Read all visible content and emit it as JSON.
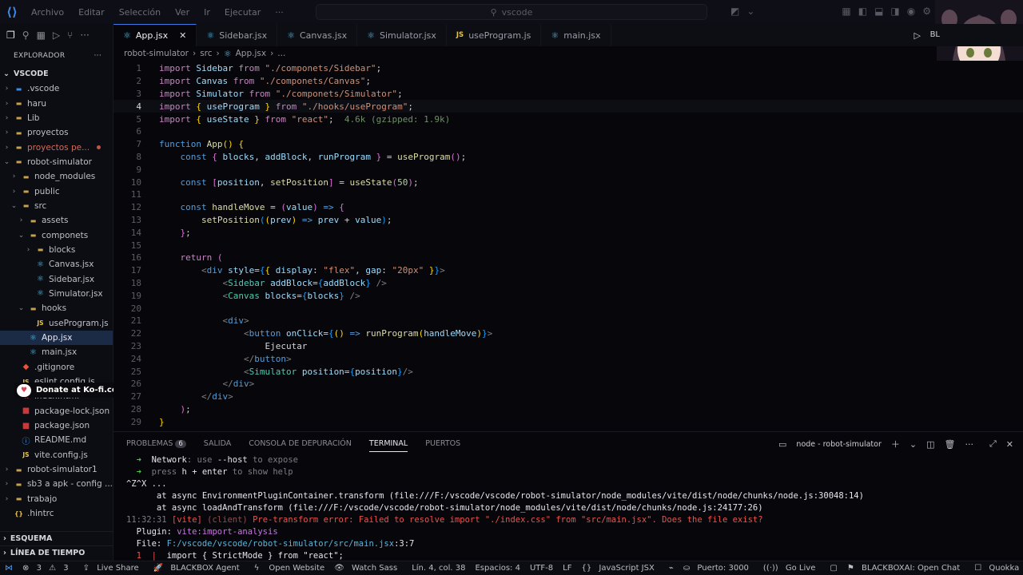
{
  "titlebar": {
    "menu": [
      "Archivo",
      "Editar",
      "Selección",
      "Ver",
      "Ir",
      "Ejecutar",
      "···"
    ],
    "search": "vscode"
  },
  "sidebar": {
    "title": "EXPLORADOR",
    "more": "···",
    "root": "VSCODE",
    "items": [
      {
        "label": ".vscode",
        "depth": 1,
        "type": "folder",
        "open": false,
        "icon": "vscode-folder-icon"
      },
      {
        "label": "haru",
        "depth": 1,
        "type": "folder",
        "open": false
      },
      {
        "label": "Lib",
        "depth": 1,
        "type": "folder",
        "open": false
      },
      {
        "label": "proyectos",
        "depth": 1,
        "type": "folder",
        "open": false
      },
      {
        "label": "proyectos pe...",
        "depth": 1,
        "type": "folder",
        "open": false,
        "modified": true
      },
      {
        "label": "robot-simulator",
        "depth": 1,
        "type": "folder",
        "open": true
      },
      {
        "label": "node_modules",
        "depth": 2,
        "type": "folder",
        "open": false
      },
      {
        "label": "public",
        "depth": 2,
        "type": "folder",
        "open": false
      },
      {
        "label": "src",
        "depth": 2,
        "type": "folder",
        "open": true
      },
      {
        "label": "assets",
        "depth": 3,
        "type": "folder",
        "open": false
      },
      {
        "label": "componets",
        "depth": 3,
        "type": "folder",
        "open": true
      },
      {
        "label": "blocks",
        "depth": 4,
        "type": "folder",
        "open": false
      },
      {
        "label": "Canvas.jsx",
        "depth": 4,
        "type": "react"
      },
      {
        "label": "Sidebar.jsx",
        "depth": 4,
        "type": "react"
      },
      {
        "label": "Simulator.jsx",
        "depth": 4,
        "type": "react"
      },
      {
        "label": "hooks",
        "depth": 3,
        "type": "folder",
        "open": true
      },
      {
        "label": "useProgram.js",
        "depth": 4,
        "type": "js"
      },
      {
        "label": "App.jsx",
        "depth": 3,
        "type": "react",
        "selected": true
      },
      {
        "label": "main.jsx",
        "depth": 3,
        "type": "react"
      },
      {
        "label": ".gitignore",
        "depth": 2,
        "type": "git"
      },
      {
        "label": "eslint.config.js",
        "depth": 2,
        "type": "js"
      },
      {
        "label": "index.html",
        "depth": 2,
        "type": "html"
      },
      {
        "label": "package-lock.json",
        "depth": 2,
        "type": "npm"
      },
      {
        "label": "package.json",
        "depth": 2,
        "type": "npm"
      },
      {
        "label": "README.md",
        "depth": 2,
        "type": "md"
      },
      {
        "label": "vite.config.js",
        "depth": 2,
        "type": "js"
      },
      {
        "label": "robot-simulator1",
        "depth": 1,
        "type": "folder",
        "open": false
      },
      {
        "label": "sb3 a apk - config ...",
        "depth": 1,
        "type": "folder",
        "open": false
      },
      {
        "label": "trabajo",
        "depth": 1,
        "type": "folder",
        "open": false
      },
      {
        "label": ".hintrc",
        "depth": 1,
        "type": "json"
      }
    ],
    "outline": "ESQUEMA",
    "timeline": "LÍNEA DE TIEMPO"
  },
  "donate": "Donate at Ko-fi.com/tiagovelko",
  "tabs": [
    {
      "label": "App.jsx",
      "type": "react",
      "active": true
    },
    {
      "label": "Sidebar.jsx",
      "type": "react"
    },
    {
      "label": "Canvas.jsx",
      "type": "react"
    },
    {
      "label": "Simulator.jsx",
      "type": "react"
    },
    {
      "label": "useProgram.js",
      "type": "js"
    },
    {
      "label": "main.jsx",
      "type": "react"
    }
  ],
  "tab_run_label": "BL",
  "breadcrumb": [
    "robot-simulator",
    "src",
    "App.jsx",
    "..."
  ],
  "editor": {
    "current_line": 4,
    "hint_line5": "4.6k (gzipped: 1.9k)"
  },
  "panel": {
    "tabs": [
      "PROBLEMAS",
      "SALIDA",
      "CONSOLA DE DEPURACIÓN",
      "TERMINAL",
      "PUERTOS"
    ],
    "problems_count": "6",
    "active_tab": "TERMINAL",
    "terminal_name": "node - robot-simulator",
    "lines": [
      "➜  Network: use --host to expose",
      "➜  press h + enter to show help",
      "^Z^X ...",
      "      at async EnvironmentPluginContainer.transform (file:///F:/vscode/vscode/robot-simulator/node_modules/vite/dist/node/chunks/node.js:30048:14)",
      "      at async loadAndTransform (file:///F:/vscode/vscode/robot-simulator/node_modules/vite/dist/node/chunks/node.js:24177:26)",
      "11:32:31 [vite] (client) Pre-transform error: Failed to resolve import \"./index.css\" from \"src/main.jsx\". Does the file exist?",
      "  Plugin: vite:import-analysis",
      "  File: F:/vscode/vscode/robot-simulator/src/main.jsx:3:7",
      "  1  |  import { StrictMode } from \"react\";"
    ]
  },
  "status": {
    "errors": "3",
    "warnings": "3",
    "live_share": "Live Share",
    "blackbox_agent": "BLACKBOX Agent",
    "open_website": "Open Website",
    "watch_sass": "Watch Sass",
    "position": "Lín. 4, col. 38",
    "spaces": "Espacios: 4",
    "encoding": "UTF-8",
    "eol": "LF",
    "language": "JavaScript JSX",
    "port": "Puerto: 3000",
    "go_live": "Go Live",
    "blackboxai": "BLACKBOXAI: Open Chat",
    "quokka": "Quokka"
  }
}
